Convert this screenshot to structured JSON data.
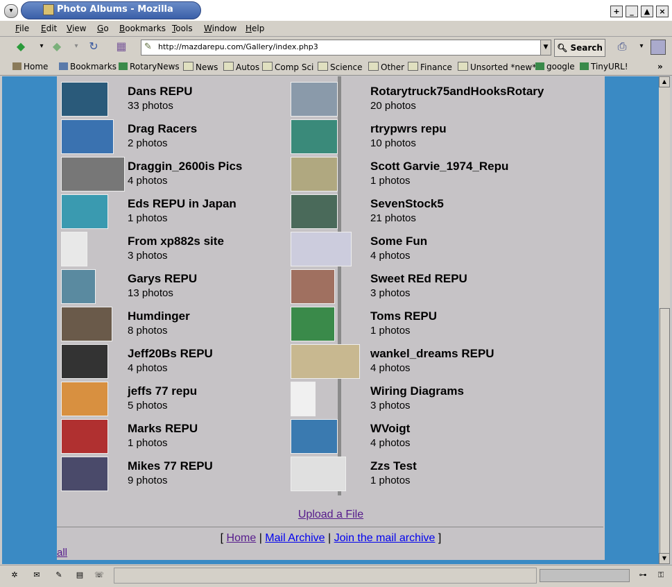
{
  "window": {
    "title": "Photo Albums - Mozilla"
  },
  "menu": [
    "File",
    "Edit",
    "View",
    "Go",
    "Bookmarks",
    "Tools",
    "Window",
    "Help"
  ],
  "nav": {
    "url": "http://mazdarepu.com/Gallery/index.php3",
    "search_label": "Search"
  },
  "bookmarks": [
    "Home",
    "Bookmarks",
    "RotaryNews",
    "News",
    "Autos",
    "Comp Sci",
    "Science",
    "Other",
    "Finance",
    "Unsorted *new*",
    "google",
    "TinyURL!"
  ],
  "albums_left": [
    {
      "name": "Dans REPU",
      "count": "33 photos",
      "color": "#2a5a7a"
    },
    {
      "name": "Drag Racers",
      "count": "2 photos",
      "color": "#3a72b0"
    },
    {
      "name": "Draggin_2600is Pics",
      "count": "4 photos",
      "color": "#777777"
    },
    {
      "name": "Eds REPU in Japan",
      "count": "1 photos",
      "color": "#3a9ab0"
    },
    {
      "name": "From xp882s site",
      "count": "3 photos",
      "color": "#e8e8e8"
    },
    {
      "name": "Garys REPU",
      "count": "13 photos",
      "color": "#5a8aa0"
    },
    {
      "name": "Humdinger",
      "count": "8 photos",
      "color": "#6a5a4a"
    },
    {
      "name": "Jeff20Bs REPU",
      "count": "4 photos",
      "color": "#333333"
    },
    {
      "name": "jeffs 77 repu",
      "count": "5 photos",
      "color": "#d89040"
    },
    {
      "name": "Marks REPU",
      "count": "1 photos",
      "color": "#b03030"
    },
    {
      "name": "Mikes 77 REPU",
      "count": "9 photos",
      "color": "#4a4a6a"
    }
  ],
  "albums_right": [
    {
      "name": "Rotarytruck75andHooksRotary",
      "count": "20 photos",
      "color": "#8a9aaa"
    },
    {
      "name": "rtrypwrs repu",
      "count": "10 photos",
      "color": "#3a8a7a"
    },
    {
      "name": "Scott Garvie_1974_Repu",
      "count": "1 photos",
      "color": "#b0a880"
    },
    {
      "name": "SevenStock5",
      "count": "21 photos",
      "color": "#4a6a5a"
    },
    {
      "name": "Some Fun",
      "count": "4 photos",
      "color": "#ccccdd"
    },
    {
      "name": "Sweet REd REPU",
      "count": "3 photos",
      "color": "#a07060"
    },
    {
      "name": "Toms REPU",
      "count": "1 photos",
      "color": "#3a8a4a"
    },
    {
      "name": "wankel_dreams REPU",
      "count": "4 photos",
      "color": "#c8b890"
    },
    {
      "name": "Wiring Diagrams",
      "count": "3 photos",
      "color": "#f0f0f0"
    },
    {
      "name": "WVoigt",
      "count": "4 photos",
      "color": "#3a7ab0"
    },
    {
      "name": "Zzs Test",
      "count": "1 photos",
      "color": "#e0e0e0"
    }
  ],
  "footer": {
    "upload": "Upload a File",
    "open_bracket": "[",
    "home": "Home",
    "sep": "|",
    "mail_archive": "Mail Archive",
    "join": "Join the mail archive",
    "close_bracket": "]",
    "all": "all"
  },
  "statusbar": {
    "icons": [
      "navigator-icon",
      "mail-icon",
      "composer-icon",
      "addressbook-icon",
      "irc-icon"
    ]
  }
}
